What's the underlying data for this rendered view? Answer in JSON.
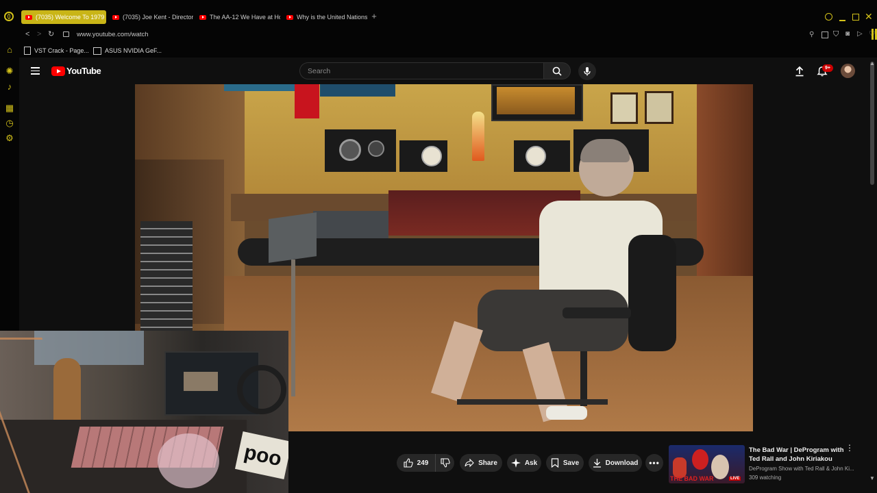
{
  "browser": {
    "tabs": [
      {
        "label": "(7035) Welcome To 1979",
        "active": true
      },
      {
        "label": "(7035) Joe Kent - Director",
        "active": false
      },
      {
        "label": "The AA-12 We Have at Ho",
        "active": false
      },
      {
        "label": "Why is the United Nations",
        "active": false
      }
    ],
    "new_tab_label": "+",
    "url": "www.youtube.com/watch",
    "bookmarks": [
      {
        "label": "VST Crack - Page..."
      },
      {
        "label": "ASUS NVIDIA GeF..."
      }
    ],
    "accent_color": "#d4c21a"
  },
  "youtube": {
    "logo_text": "YouTube",
    "search_placeholder": "Search",
    "notification_badge": "9+",
    "actions": {
      "likes": "249",
      "share": "Share",
      "ask": "Ask",
      "save": "Save",
      "download": "Download"
    },
    "recommended": {
      "title_line1": "The Bad War | DeProgram with",
      "title_line2": "Ted Rall and John Kiriakou",
      "channel": "DeProgram Show with Ted Rall & John Ki...",
      "watching": "309 watching",
      "thumb_text": "THE BAD WAR",
      "thumb_badge": "LIVE"
    }
  },
  "video_scene": {
    "webcam_text": "poo"
  }
}
